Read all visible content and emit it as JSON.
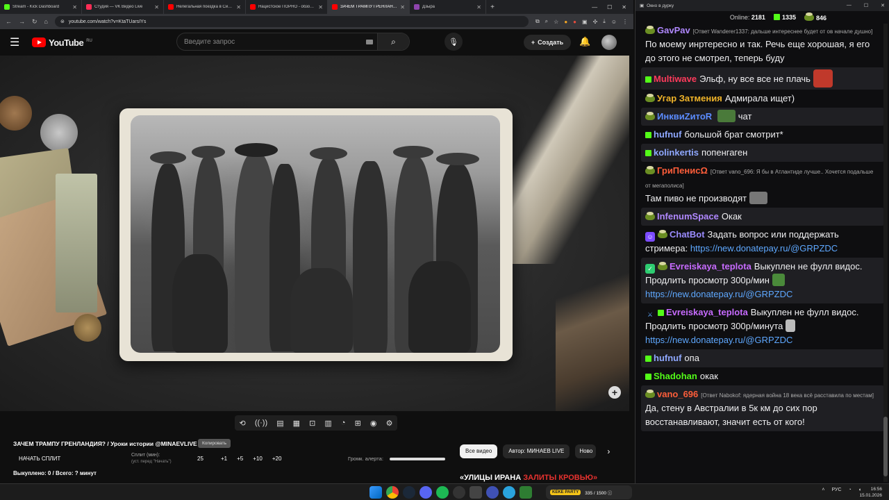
{
  "browser": {
    "tabs": [
      {
        "title": "Stream - Kick Dashboard",
        "color": "#53fc18"
      },
      {
        "title": "Студия — VK Видео Live",
        "color": "#ff2d55"
      },
      {
        "title": "Нелегальная поездка в Сирию",
        "color": "#ff0000"
      },
      {
        "title": "Нацистское ПОРНО - обзор ф",
        "color": "#ff0000"
      },
      {
        "title": "ЗАЧЕМ ТРАМПУ ГРЕНЛАНДИЯ",
        "color": "#ff0000"
      },
      {
        "title": "Дзыра",
        "color": "#8e44ad"
      }
    ],
    "new_tab": "+",
    "url": "youtube.com/watch?v=KtaTUarsIYs",
    "window_controls": [
      "—",
      "☐",
      "✕"
    ]
  },
  "youtube": {
    "logo_text": "YouTube",
    "region": "RU",
    "search_placeholder": "Введите запрос",
    "create_label": "Создать",
    "video_title": "ЗАЧЕМ ТРАМПУ ГРЕНЛАНДИЯ? / Уроки истории @MINAEVLIVE",
    "copy_label": "Копировать"
  },
  "widget": {
    "start_split": "НАЧАТЬ СПЛИТ",
    "split_label": "Сплит (мин):",
    "split_hint": "(уст. перед \"Начать\")",
    "split_value": "25",
    "increments": [
      "+1",
      "+5",
      "+10",
      "+20"
    ],
    "volume_label": "Громк. алерта:",
    "bought": "Выкуплено: 0 / Всего: ? минут",
    "tools": [
      "⟲",
      "((·))",
      "▤",
      "▦",
      "⊡",
      "▥",
      "◔",
      "⊞",
      "◉",
      "⚙"
    ]
  },
  "chips": {
    "all": "Все видео",
    "author": "Автор: МИНАЕВ LIVE",
    "new": "Ново",
    "next": "›"
  },
  "promo": {
    "white": "«УЛИЦЫ ИРАНА ",
    "red": "ЗАЛИТЫ КРОВЬЮ»"
  },
  "chat": {
    "window_title": "Окно в дурку",
    "online_label": "Online:",
    "online": "2181",
    "kick_count": "1335",
    "other_count": "846",
    "messages": [
      {
        "user": "GavPav",
        "color": "#b088ff",
        "badge": "pepe",
        "reply": "[Ответ Wanderer1337: дальше интереснее будет от ов начале душно]",
        "text": "По моему инртересно и так. Речь еще хорошая, я его до этого не смотрел, теперь буду"
      },
      {
        "user": "Multiwave",
        "color": "#ff3b5c",
        "badge": "kick",
        "text": "Эльф, ну все все не плачь",
        "emote": "#c0392b"
      },
      {
        "user": "Угар Затмения",
        "color": "#f0b429",
        "badge": "pepe",
        "text": "Адмирала ищет)"
      },
      {
        "user": "ИнквиZитоR",
        "color": "#5b8cff",
        "badge": "pepe",
        "text": "чат",
        "emote": "#4a7a3a"
      },
      {
        "user": "hufnuf",
        "color": "#8fa8ff",
        "badge": "kick",
        "text": "большой брат смотрит*"
      },
      {
        "user": "kolinkertis",
        "color": "#8fa8ff",
        "badge": "kick",
        "text": "попенгаген"
      },
      {
        "user": "ГриПенисΩ",
        "color": "#ff5e3a",
        "badge": "pepe",
        "reply": "[Ответ vano_696: Я бы в Атлантиде лучше.. Хочется подальше от мегаполиса]",
        "text": "Там пиво не производят",
        "emote": "#777777"
      },
      {
        "user": "InfenumSpace",
        "color": "#b088ff",
        "badge": "pepe",
        "text": "Окак"
      },
      {
        "user": "ChatBot",
        "color": "#9b8cff",
        "badge": "bot",
        "text": "Задать вопрос или поддержать стримера:",
        "link": "https://new.donatepay.ru/@GRPZDC"
      },
      {
        "user": "Evreiskaya_teplota",
        "color": "#c76bff",
        "badge": "check",
        "text": "Выкуплен не фулл видос. Продлить просмотр 300р/мин",
        "link": "https://new.donatepay.ru/@GRPZDC"
      },
      {
        "user": "Evreiskaya_teplota",
        "color": "#c76bff",
        "badge": "sword",
        "text": "Выкуплен не фулл видос. Продлить просмотр 300р/минута",
        "link": "https://new.donatepay.ru/@GRPZDC"
      },
      {
        "user": "hufnuf",
        "color": "#8fa8ff",
        "badge": "kick",
        "text": "опа"
      },
      {
        "user": "Shadohan",
        "color": "#53fc18",
        "badge": "kick",
        "text": "окак"
      },
      {
        "user": "vano_696",
        "color": "#ff5e3a",
        "badge": "pepe",
        "reply": "[Ответ Nabokof: ядерная война 18 века всё расставила по местам]",
        "text": "Да, стену в Австралии в 5к км до сих пор восстанавливают, значит есть от кого!"
      }
    ]
  },
  "taskbar": {
    "kick_label": "KEKE PARTY",
    "kick_progress": "335 / 1500 ⓘ",
    "lang": "РУС",
    "time": "16:56",
    "date": "15.01.2026"
  }
}
